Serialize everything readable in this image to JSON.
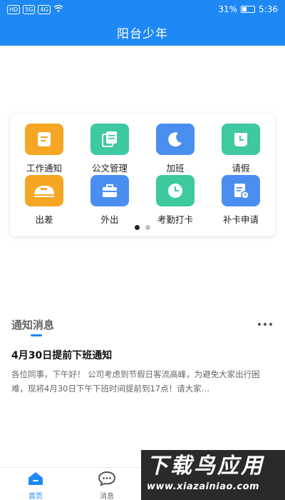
{
  "status_bar": {
    "left_chips": [
      "HD",
      "5G",
      "4G"
    ],
    "battery": "31%",
    "time": "5:36"
  },
  "header": {
    "title": "阳台少年"
  },
  "grid": {
    "items": [
      {
        "label": "工作通知",
        "icon": "document-icon",
        "color": "#f5a623"
      },
      {
        "label": "公文管理",
        "icon": "files-icon",
        "color": "#3ec9a0"
      },
      {
        "label": "加班",
        "icon": "moon-icon",
        "color": "#4a8ff0"
      },
      {
        "label": "请假",
        "icon": "calendar-clock-icon",
        "color": "#3ec9a0"
      },
      {
        "label": "出差",
        "icon": "train-icon",
        "color": "#f5a623"
      },
      {
        "label": "外出",
        "icon": "briefcase-icon",
        "color": "#4a8ff0"
      },
      {
        "label": "考勤打卡",
        "icon": "clock-icon",
        "color": "#3ec9a0"
      },
      {
        "label": "补卡申请",
        "icon": "form-icon",
        "color": "#4a8ff0"
      }
    ],
    "page_count": 2,
    "active_page": 0
  },
  "notice": {
    "section_title": "通知消息",
    "items": [
      {
        "title": "4月30日提前下班通知",
        "body": "各位同事，下午好！ 公司考虑到节假日客流高峰，为避免大家出行困难，现将4月30日下午下班时间提前到17点！请大家…"
      }
    ]
  },
  "tabbar": {
    "tabs": [
      {
        "label": "首页",
        "icon": "home-icon",
        "active": true
      },
      {
        "label": "消息",
        "icon": "chat-icon",
        "active": false
      }
    ]
  },
  "watermark": {
    "main": "下载鸟应用",
    "url": "www.xiazainiao.com"
  },
  "colors": {
    "primary": "#1e88f5",
    "orange": "#f5a623",
    "green": "#3ec9a0",
    "blue": "#4a8ff0"
  }
}
